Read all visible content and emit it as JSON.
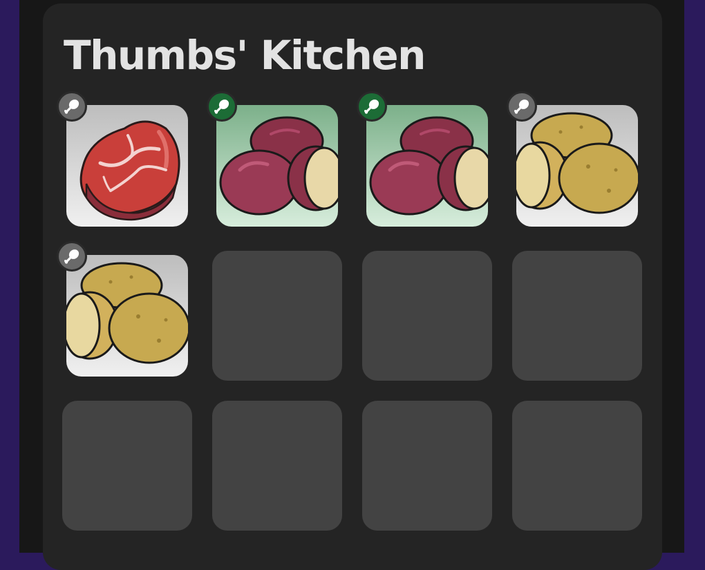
{
  "kitchen": {
    "title": "Thumbs' Kitchen",
    "slots": [
      {
        "item": "raw-meat",
        "tag_color": "grey"
      },
      {
        "item": "red-potatoes",
        "tag_color": "green"
      },
      {
        "item": "red-potatoes",
        "tag_color": "green"
      },
      {
        "item": "potatoes",
        "tag_color": "grey"
      },
      {
        "item": "potatoes",
        "tag_color": "grey"
      },
      {
        "item": null
      },
      {
        "item": null
      },
      {
        "item": null
      },
      {
        "item": null
      },
      {
        "item": null
      },
      {
        "item": null
      },
      {
        "item": null
      }
    ]
  },
  "colors": {
    "background_frame": "#2b1a5c",
    "panel": "#242424",
    "empty_slot": "#434343",
    "tag_grey": "#6a6a6a",
    "tag_green": "#1c6c36",
    "title_text": "#e3e3e3"
  },
  "icons": {
    "slot_tag": "meat-drumstick-icon"
  }
}
